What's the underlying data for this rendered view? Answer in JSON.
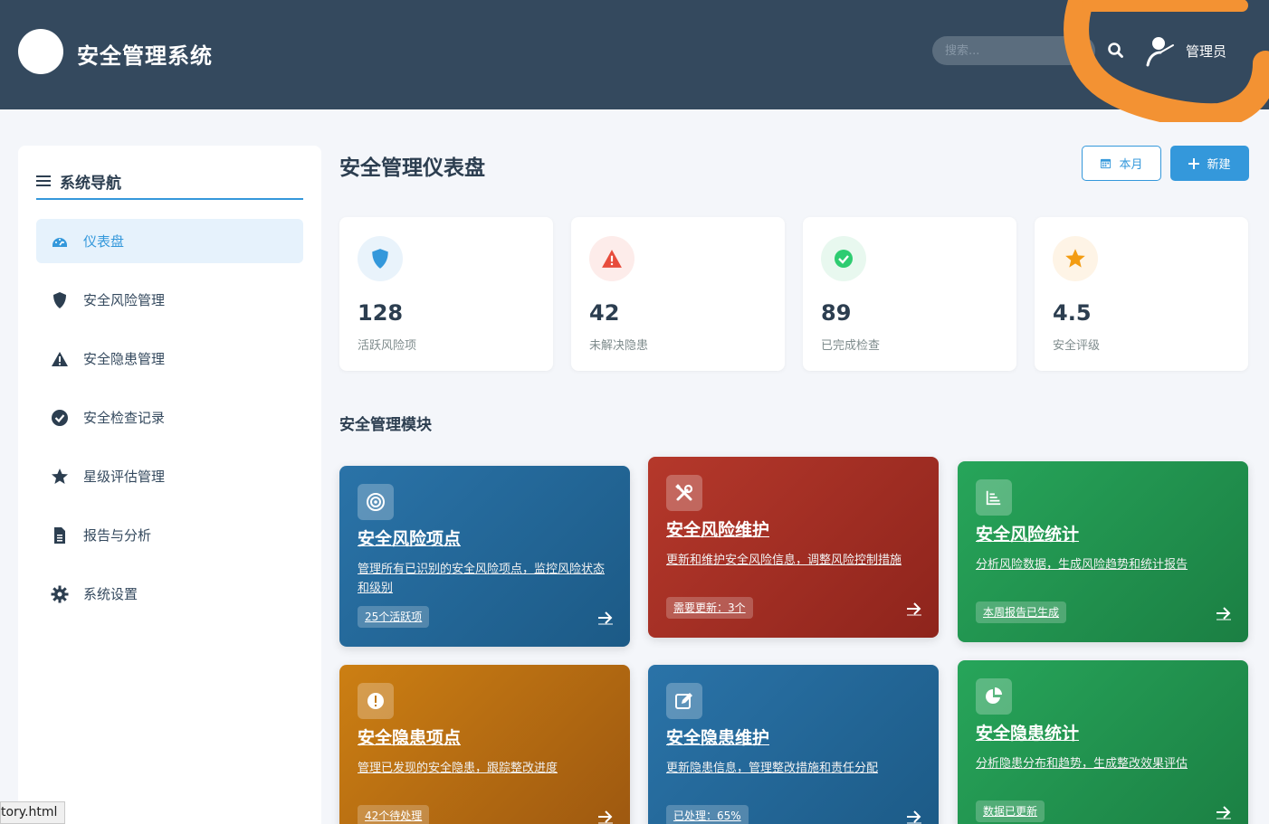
{
  "header": {
    "app_title": "安全管理系统",
    "search_placeholder": "搜索...",
    "user_name": "管理员"
  },
  "sidebar": {
    "heading": "系统导航",
    "items": [
      {
        "label": "仪表盘",
        "icon": "dashboard-icon",
        "active": true
      },
      {
        "label": "安全风险管理",
        "icon": "shield-icon",
        "active": false
      },
      {
        "label": "安全隐患管理",
        "icon": "warning-icon",
        "active": false
      },
      {
        "label": "安全检查记录",
        "icon": "check-circle-icon",
        "active": false
      },
      {
        "label": "星级评估管理",
        "icon": "star-icon",
        "active": false
      },
      {
        "label": "报告与分析",
        "icon": "document-icon",
        "active": false
      },
      {
        "label": "系统设置",
        "icon": "gear-icon",
        "active": false
      }
    ]
  },
  "main": {
    "page_title": "安全管理仪表盘",
    "btn_month": "本月",
    "btn_new": "新建",
    "stats": [
      {
        "value": "128",
        "label": "活跃风险项",
        "icon": "shield-icon",
        "color": "#3498db"
      },
      {
        "value": "42",
        "label": "未解决隐患",
        "icon": "warning-icon",
        "color": "#e74c3c"
      },
      {
        "value": "89",
        "label": "已完成检查",
        "icon": "check-circle-icon",
        "color": "#2ecc71"
      },
      {
        "value": "4.5",
        "label": "安全评级",
        "icon": "star-icon",
        "color": "#f39c12"
      }
    ],
    "section_title": "安全管理模块",
    "modules": [
      {
        "title": "安全风险项点",
        "desc": "管理所有已识别的安全风险项点，监控风险状态和级别",
        "badge": "25个活跃项",
        "icon": "target-icon"
      },
      {
        "title": "安全风险维护",
        "desc": "更新和维护安全风险信息，调整风险控制措施",
        "badge": "需要更新：3个",
        "icon": "tools-icon"
      },
      {
        "title": "安全风险统计",
        "desc": "分析风险数据，生成风险趋势和统计报告",
        "badge": "本周报告已生成",
        "icon": "bar-chart-icon"
      },
      {
        "title": "安全隐患项点",
        "desc": "管理已发现的安全隐患，跟踪整改进度",
        "badge": "42个待处理",
        "icon": "exclamation-icon"
      },
      {
        "title": "安全隐患维护",
        "desc": "更新隐患信息，管理整改措施和责任分配",
        "badge": "已处理：65%",
        "icon": "edit-icon"
      },
      {
        "title": "安全隐患统计",
        "desc": "分析隐患分布和趋势，生成整改效果评估",
        "badge": "数据已更新",
        "icon": "pie-chart-icon"
      }
    ]
  },
  "status_bar": {
    "url": "tory.html"
  }
}
